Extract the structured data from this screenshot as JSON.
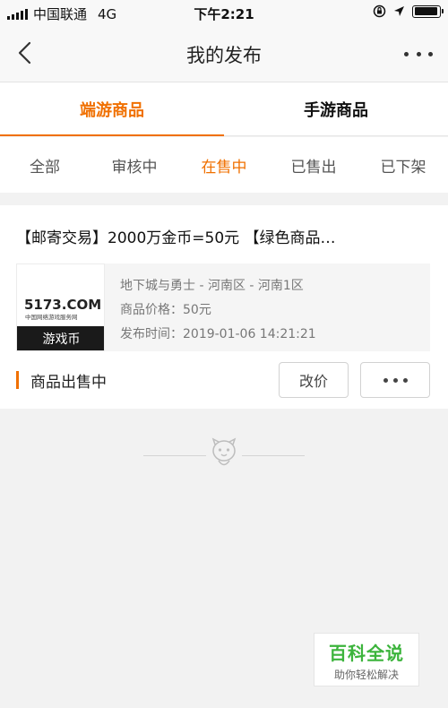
{
  "status_bar": {
    "carrier": "中国联通",
    "network": "4G",
    "time": "下午2:21",
    "battery_level": 0.95
  },
  "nav": {
    "title": "我的发布",
    "back_icon": "chevron-left-icon",
    "more_icon": "more-dots-icon"
  },
  "main_tabs": [
    {
      "label": "端游商品",
      "active": true
    },
    {
      "label": "手游商品",
      "active": false
    }
  ],
  "filter_tabs": [
    {
      "label": "全部",
      "active": false
    },
    {
      "label": "审核中",
      "active": false
    },
    {
      "label": "在售中",
      "active": true
    },
    {
      "label": "已售出",
      "active": false
    },
    {
      "label": "已下架",
      "active": false
    }
  ],
  "listing": {
    "title": "【邮寄交易】2000万金币=50元 【绿色商品…",
    "thumb_label": "游戏币",
    "thumb_logo_text": "5173.COM",
    "thumb_logo_sub": "中国网络游戏服务网",
    "game": "地下城与勇士 - 河南区 - 河南1区",
    "price_line": "商品价格：50元",
    "time_line": "发布时间：2019-01-06 14:21:21",
    "status": "商品出售中",
    "change_price_button": "改价"
  },
  "watermark": {
    "main": "百科全说",
    "sub": "助你轻松解决"
  },
  "colors": {
    "accent": "#f07000",
    "watermark_green": "#3cb43c"
  }
}
